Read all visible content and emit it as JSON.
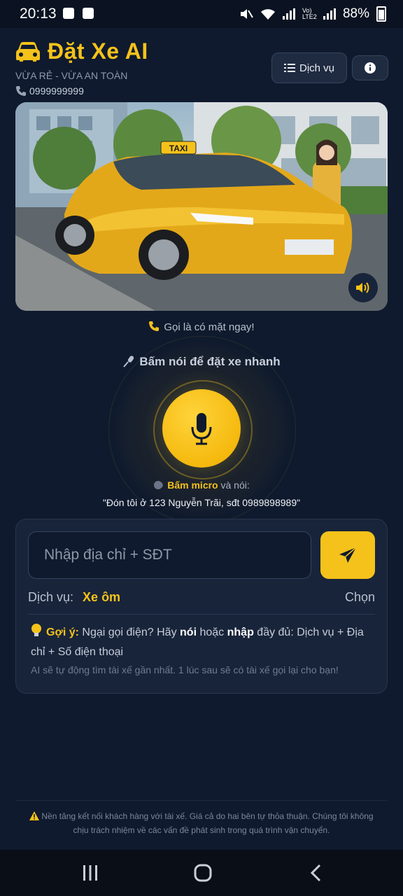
{
  "status_bar": {
    "time": "20:13",
    "battery": "88%",
    "network_label": "Vo) LTE2"
  },
  "header": {
    "title": "Đặt Xe AI",
    "tagline": "VỪA RẺ - VỪA AN TOÀN",
    "phone": "0999999999",
    "services_button": "Dịch vụ"
  },
  "hero": {
    "taxi_sign": "TAXI",
    "call_note": "Gọi là có mặt ngay!"
  },
  "voice": {
    "title": "Bấm nói để đặt xe nhanh",
    "hint_bold": "Bấm micro",
    "hint_rest": " và nói:",
    "example": "\"Đón tôi ở 123 Nguyễn Trãi, sđt 0989898989\""
  },
  "form": {
    "address_placeholder": "Nhập địa chỉ + SĐT",
    "address_value": "",
    "service_label": "Dịch vụ:",
    "service_value": "Xe ôm",
    "choose_label": "Chọn",
    "tip_label": "Gợi ý:",
    "tip_part1": " Ngại gọi điện? Hãy ",
    "tip_bold1": "nói",
    "tip_part2": " hoặc ",
    "tip_bold2": "nhập",
    "tip_part3": " đầy đủ: Dịch vụ + Địa chỉ + Số điện thoại",
    "tip_sub": "AI sẽ tự động tìm tài xế gần nhất. 1 lúc sau sẽ có tài xế gọi lại cho bạn!"
  },
  "footer": {
    "disclaimer": "Nền tảng kết nối khách hàng với tài xế. Giá cả do hai bên tự thỏa thuận. Chúng tôi không chịu trách nhiệm về các vấn đề phát sinh trong quá trình vận chuyển."
  },
  "colors": {
    "accent": "#f5c21b",
    "background": "#0f1a2e",
    "card": "#18243a"
  }
}
